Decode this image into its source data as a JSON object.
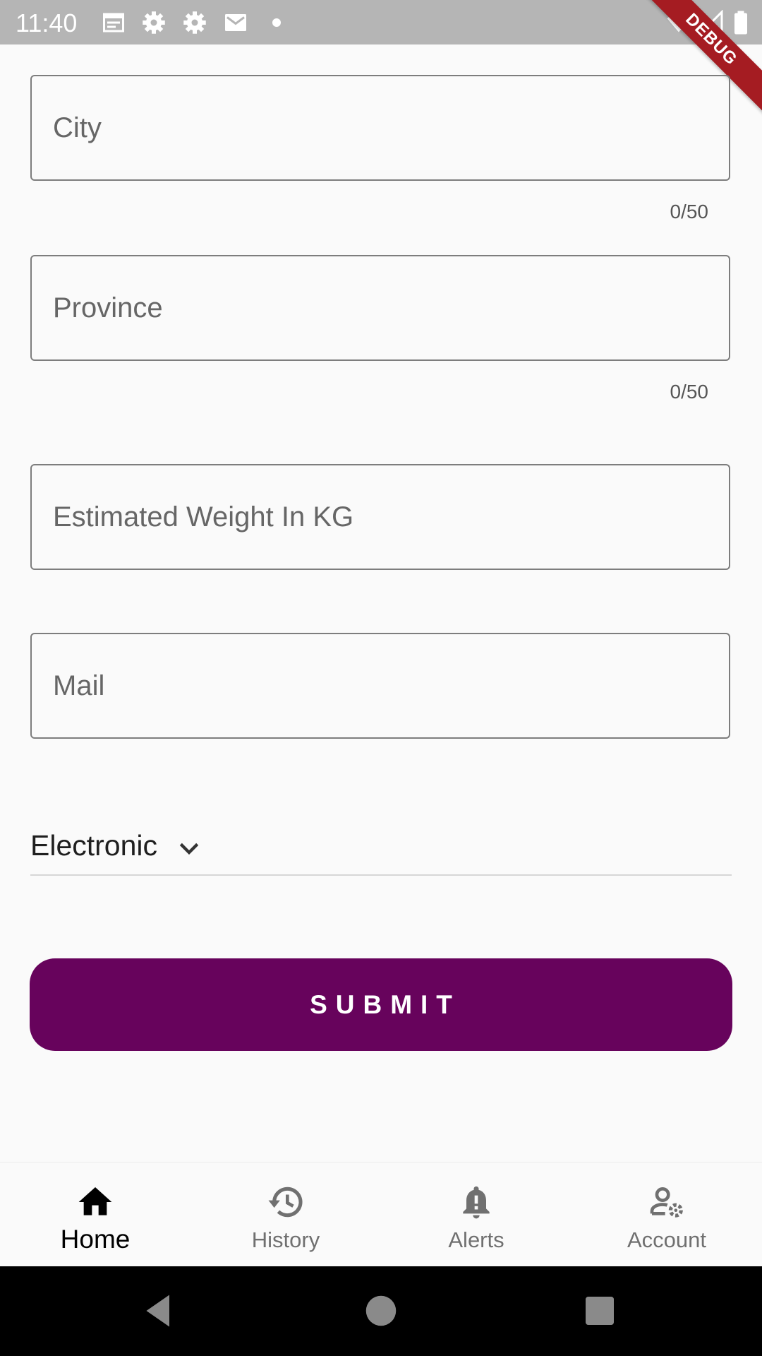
{
  "status_bar": {
    "time": "11:40",
    "icons": [
      "calendar-icon",
      "settings-icon",
      "settings-icon",
      "mail-icon",
      "notification-dot",
      "wifi-icon",
      "signal-icon",
      "battery-icon"
    ],
    "debug_banner": "DEBUG"
  },
  "form": {
    "city": {
      "placeholder": "City",
      "value": "",
      "counter": "0/50"
    },
    "province": {
      "placeholder": "Province",
      "value": "",
      "counter": "0/50"
    },
    "weight": {
      "placeholder": "Estimated Weight In KG",
      "value": ""
    },
    "mail": {
      "placeholder": "Mail",
      "value": ""
    },
    "category": {
      "selected": "Electronic"
    },
    "submit_label": "SUBMIT"
  },
  "bottom_nav": {
    "items": [
      {
        "label": "Home",
        "icon": "home-icon",
        "active": true
      },
      {
        "label": "History",
        "icon": "history-icon",
        "active": false
      },
      {
        "label": "Alerts",
        "icon": "bell-icon",
        "active": false
      },
      {
        "label": "Account",
        "icon": "account-settings-icon",
        "active": false
      }
    ]
  },
  "colors": {
    "accent": "#67035c",
    "status_bar": "#b5b5b5",
    "debug_banner": "#a51c22",
    "active_nav": "#000000",
    "inactive_nav": "#707070"
  }
}
